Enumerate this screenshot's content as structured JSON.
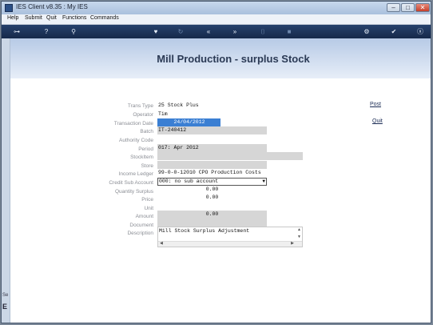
{
  "window": {
    "title": "IES Client v8.35 : My IES",
    "min": "–",
    "max": "□",
    "close": "✕"
  },
  "menu": [
    "Help",
    "Submit",
    "Quit",
    "Functions",
    "Commands"
  ],
  "toolbar": {
    "key": "⊶",
    "help": "?",
    "search": "⚲",
    "heart": "♥",
    "refresh": "↻",
    "rewind": "«",
    "forward": "»",
    "mark": "⌷",
    "stop": "■",
    "gear": "⚙",
    "ok": "✔",
    "close": "ⓧ"
  },
  "left_strip": {
    "se": "Se",
    "e": "E"
  },
  "form": {
    "title": "Mill Production - surplus Stock",
    "labels": {
      "trans_type": "Trans Type",
      "operator": "Operator",
      "transaction_date": "Transaction Date",
      "batch": "Batch",
      "authority_code": "Authority Code",
      "period": "Period",
      "stock_item": "StockItem",
      "store": "Store",
      "income_ledger": "Income Ledger",
      "credit_sub_account": "Credit Sub Account",
      "quantity_surplus": "Quantity Surplus",
      "price": "Price",
      "unit": "Unit",
      "amount": "Amount",
      "document": "Document",
      "description": "Description"
    },
    "values": {
      "trans_type": "25 Stock Plus",
      "operator": "Tim",
      "transaction_date": "24/04/2012",
      "batch": "IT-240412",
      "authority_code": "",
      "period": "017: Apr 2012",
      "stock_item": "",
      "store": "",
      "income_ledger": "99-0-0-12010 CPO Production Costs",
      "credit_sub_account": "000: no sub account",
      "quantity_surplus": "0.00",
      "price": "0.00",
      "unit": "",
      "amount": "0.00",
      "document": "",
      "description": "Mill Stock Surplus Adjustment"
    },
    "actions": {
      "post": "Post",
      "quit": "Quit"
    }
  }
}
